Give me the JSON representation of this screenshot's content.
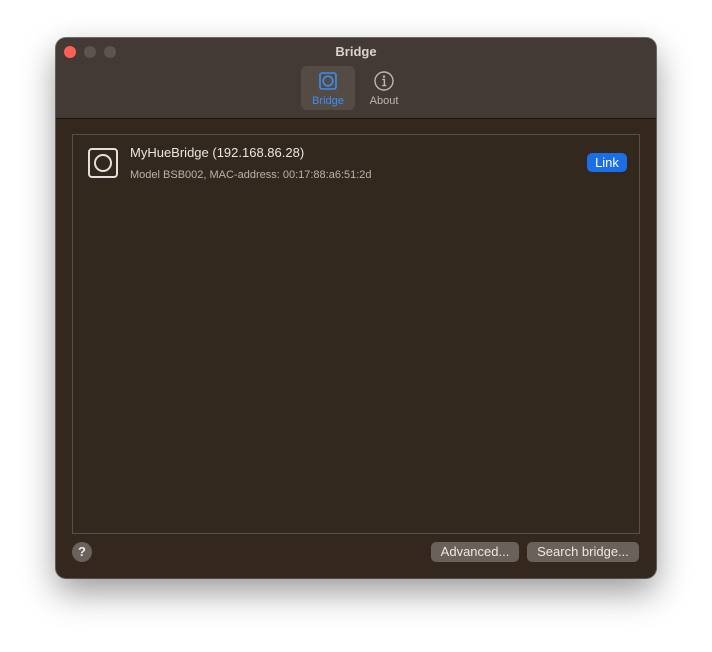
{
  "window": {
    "title": "Bridge"
  },
  "toolbar": {
    "tabs": [
      {
        "label": "Bridge",
        "icon": "bridge-icon",
        "selected": true
      },
      {
        "label": "About",
        "icon": "info-icon",
        "selected": false
      }
    ]
  },
  "bridges": [
    {
      "name": "MyHueBridge (192.168.86.28)",
      "detail": "Model BSB002, MAC-address: 00:17:88:a6:51:2d",
      "action_label": "Link",
      "icon": "hue-bridge-icon"
    }
  ],
  "footer": {
    "help_label": "?",
    "advanced_label": "Advanced...",
    "search_label": "Search bridge..."
  },
  "colors": {
    "accent": "#1a6ee8",
    "selected_tab": "#3b8ff2",
    "close": "#fe5f57",
    "background": "#34281e"
  }
}
